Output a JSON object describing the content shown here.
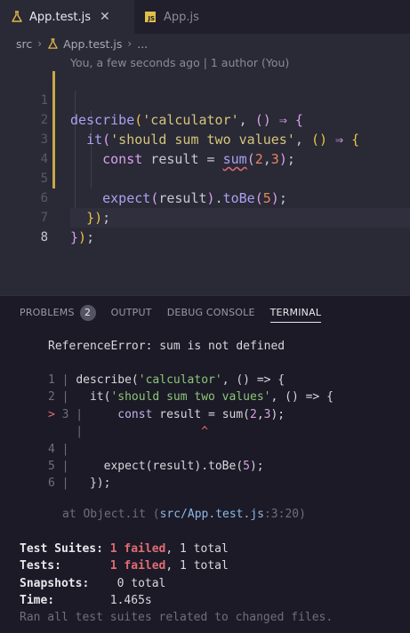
{
  "tabs": [
    {
      "label": "App.test.js",
      "icon": "flask-icon",
      "active": true
    },
    {
      "label": "App.js",
      "icon": "js-file-icon",
      "active": false
    }
  ],
  "tab_close_glyph": "✕",
  "js_badge_text": "JS",
  "breadcrumb": {
    "folder": "src",
    "file": "App.test.js",
    "more": "..."
  },
  "codelens": "You, a few seconds ago | 1 author (You)",
  "editor": {
    "line_numbers": [
      "1",
      "2",
      "3",
      "4",
      "5",
      "6",
      "7",
      "8"
    ],
    "current_line": "8"
  },
  "panel": {
    "tabs": [
      "PROBLEMS",
      "OUTPUT",
      "DEBUG CONSOLE",
      "TERMINAL"
    ],
    "problems_count": "2",
    "active_tab": "TERMINAL"
  },
  "terminal": {
    "error": "ReferenceError: sum is not defined",
    "snippet_numbers": [
      "1",
      "2",
      "3",
      "4",
      "5",
      "6"
    ],
    "error_marker": ">",
    "caret": "^",
    "location_prefix": "at Object.it (",
    "location_file": "src/App.test.js",
    "location_suffix": ":3:20)",
    "summary": {
      "suites_label": "Test Suites:",
      "suites_failed": "1 failed",
      "suites_total": ", 1 total",
      "tests_label": "Tests:",
      "tests_failed": "1 failed",
      "tests_total": ", 1 total",
      "snapshots_label": "Snapshots:",
      "snapshots_value": "0 total",
      "time_label": "Time:",
      "time_value": "1.465s",
      "footer": "Ran all test suites related to changed files."
    }
  },
  "colors": {
    "accent_modified": "#c9a647",
    "error": "#e06c75",
    "badge_js": "#e0c04a"
  }
}
